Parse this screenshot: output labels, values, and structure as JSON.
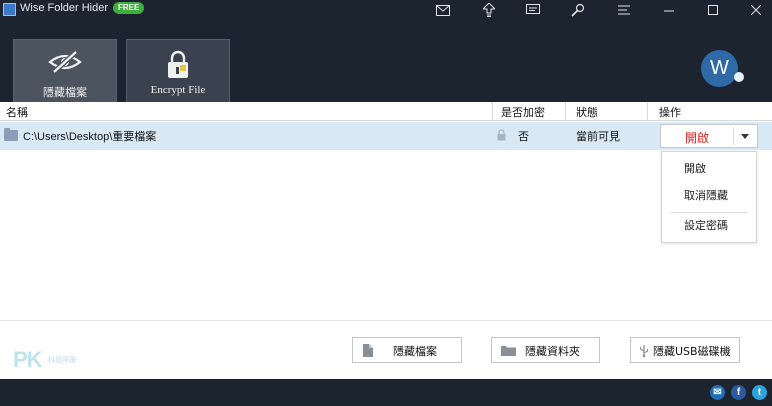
{
  "titlebar": {
    "title": "Wise Folder Hider",
    "badge": "FREE",
    "icons": [
      "mail-icon",
      "upgrade-icon",
      "feedback-icon",
      "settings-icon",
      "menu-icon",
      "minimize-icon",
      "maximize-icon",
      "close-icon"
    ]
  },
  "tabs": [
    {
      "label": "隱藏檔案",
      "icon": "eye-slash-icon",
      "active": true
    },
    {
      "label": "Encrypt File",
      "icon": "padlock-icon",
      "active": false
    }
  ],
  "avatar": {
    "letter": "W"
  },
  "columns": {
    "name": "名稱",
    "encrypted": "是否加密",
    "status": "狀態",
    "action": "操作"
  },
  "rows": [
    {
      "path": "C:\\Users\\Desktop\\重要檔案",
      "encrypted": "否",
      "status": "當前可見",
      "action": "開啟"
    }
  ],
  "dropdown": {
    "items": [
      "開啟",
      "取消隱藏",
      "設定密碼"
    ]
  },
  "buttons": {
    "hide_file": "隱藏檔案",
    "hide_folder": "隱藏資料夾",
    "hide_usb": "隱藏USB磁碟機"
  },
  "watermark": {
    "logo": "PK",
    "text": "科技阿姆"
  },
  "social": {
    "email": "✉",
    "facebook": "f",
    "twitter": "t"
  },
  "colors": {
    "dark": "#1c2430",
    "tab_active": "#4c545f",
    "row_selected": "#d8e9f5",
    "action_red": "#dd2222",
    "free_green": "#3dae3d",
    "avatar_blue": "#2f6aa6"
  }
}
